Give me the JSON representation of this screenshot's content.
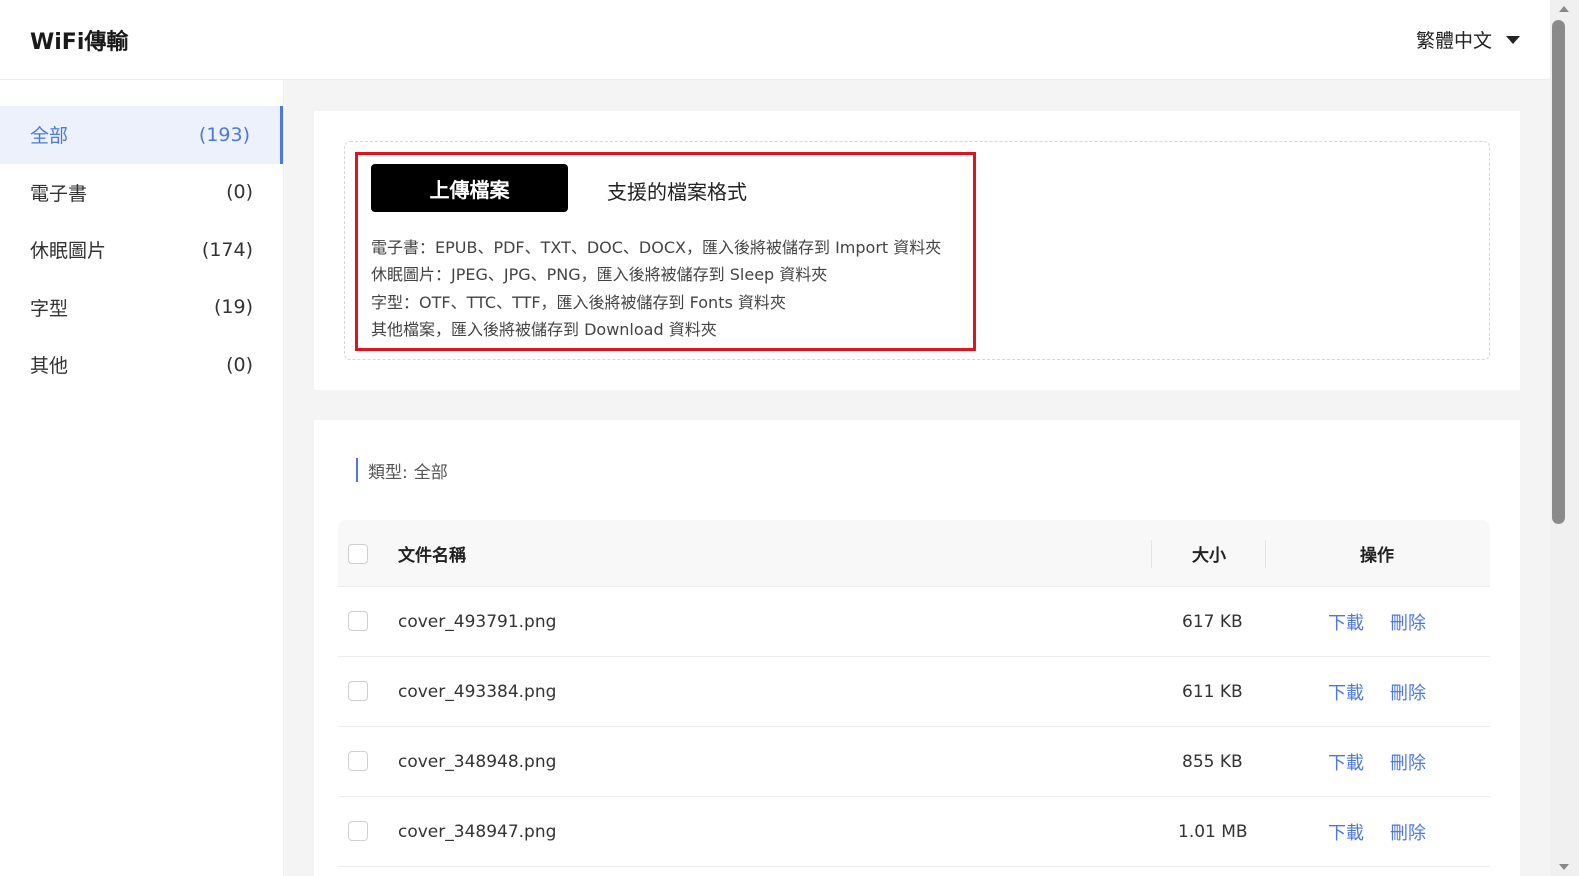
{
  "header": {
    "title": "WiFi傳輸",
    "language": "繁體中文"
  },
  "sidebar": {
    "items": [
      {
        "label": "全部",
        "count": "(193)"
      },
      {
        "label": "電子書",
        "count": "(0)"
      },
      {
        "label": "休眠圖片",
        "count": "(174)"
      },
      {
        "label": "字型",
        "count": "(19)"
      },
      {
        "label": "其他",
        "count": "(0)"
      }
    ]
  },
  "upload": {
    "button_label": "上傳檔案",
    "formats_title": "支援的檔案格式",
    "formats": [
      "電子書：EPUB、PDF、TXT、DOC、DOCX，匯入後將被儲存到 Import 資料夾",
      "休眠圖片：JPEG、JPG、PNG，匯入後將被儲存到 Sleep 資料夾",
      "字型：OTF、TTC、TTF，匯入後將被儲存到 Fonts 資料夾",
      "其他檔案，匯入後將被儲存到 Download 資料夾"
    ]
  },
  "filter": {
    "label": "類型:",
    "value": "全部"
  },
  "table": {
    "headers": {
      "name": "文件名稱",
      "size": "大小",
      "actions": "操作"
    },
    "download_label": "下載",
    "delete_label": "刪除",
    "rows": [
      {
        "name": "cover_493791.png",
        "size": "617 KB"
      },
      {
        "name": "cover_493384.png",
        "size": "611 KB"
      },
      {
        "name": "cover_348948.png",
        "size": "855 KB"
      },
      {
        "name": "cover_348947.png",
        "size": "1.01 MB"
      }
    ]
  },
  "colors": {
    "accent": "#4c78e0",
    "highlight_border": "#e0141e",
    "primary_button": "#000000"
  }
}
